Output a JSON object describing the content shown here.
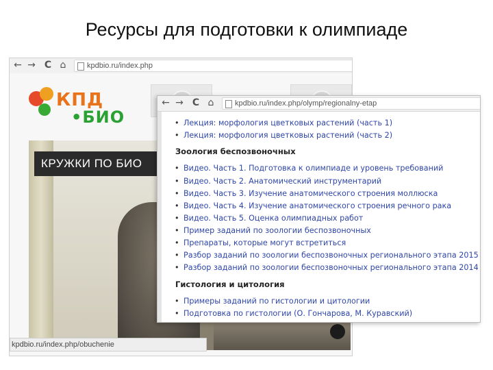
{
  "slide_title": "Ресурсы для подготовки к олимпиаде",
  "back_window": {
    "nav": {
      "back": "←",
      "forward": "→",
      "reload": "C",
      "home": "⌂"
    },
    "url": "kpdbio.ru/index.php",
    "logo": {
      "top": "КПД",
      "bottom": "•БИО"
    },
    "banner_text": "КРУЖКИ ПО БИО",
    "status_url": "kpdbio.ru/index.php/obuchenie"
  },
  "front_window": {
    "nav": {
      "back": "←",
      "forward": "→",
      "reload": "C",
      "home": "⌂"
    },
    "url": "kpdbio.ru/index.php/olymp/regionalny-etap",
    "items_top": [
      "Лекция: морфология цветковых растений (часть 1)",
      "Лекция: морфология цветковых растений (часть 2)"
    ],
    "section_zoology": "Зоология беспозвоночных",
    "items_zoology": [
      "Видео. Часть 1. Подготовка к олимпиаде и уровень требований",
      "Видео. Часть 2. Анатомический инструментарий",
      "Видео. Часть 3. Изучение анатомического строения моллюска",
      "Видео. Часть 4. Изучение анатомического строения речного рака",
      "Видео. Часть 5. Оценка олимпиадных работ",
      "Пример заданий по зоологии беспозвоночных",
      "Препараты, которые могут встретиться",
      "Разбор заданий по зоологии беспозвоночных регионального этапа 2015",
      "Разбор заданий по зоологии беспозвоночных регионального этапа 2014"
    ],
    "section_histology": "Гистология и цитология",
    "items_histology": [
      "Примеры заданий по гистологии и цитологии",
      "Подготовка по гистологии (О. Гончарова, М. Куравский)"
    ]
  }
}
